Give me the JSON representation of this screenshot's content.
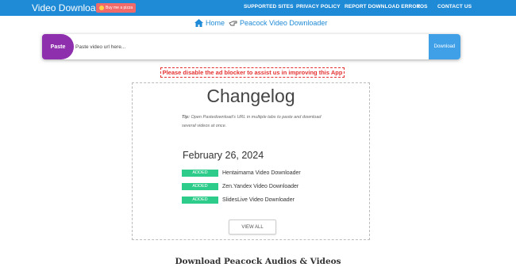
{
  "header": {
    "brand": "Video Downloader",
    "pizza_label": "Buy me a pizza",
    "nav": [
      "SUPPORTED SITES",
      "PRIVACY POLICY",
      "REPORT DOWNLOAD ERROR",
      "TOS",
      "CONTACT US"
    ]
  },
  "breadcrumb": {
    "home": "Home",
    "current": "Peacock Video Downloader"
  },
  "search": {
    "paste_label": "Paste",
    "placeholder": "Paste video url here...",
    "download_label": "Download"
  },
  "notice": "Please disable the ad blocker to assist us in improving this App",
  "changelog": {
    "title": "Changelog",
    "tip_label": "Tip:",
    "tip_text": "Open Pastedownload's URL in multiple tabs to paste and download several videos at once.",
    "date": "February 26, 2024",
    "entries": [
      {
        "badge": "ADDED",
        "text": "Hentaimama Video Downloader"
      },
      {
        "badge": "ADDED",
        "text": "Zen.Yandex Video Downloader"
      },
      {
        "badge": "ADDED",
        "text": "SlidesLive Video Downloader"
      }
    ],
    "view_all": "VIEW ALL"
  },
  "footer_heading": "Download Peacock Audios & Videos",
  "colors": {
    "topbar": "#1f8ad6",
    "paste": "#8e2fae",
    "download": "#3fa0e8",
    "added": "#2ecc8a",
    "notice": "#e53030"
  }
}
